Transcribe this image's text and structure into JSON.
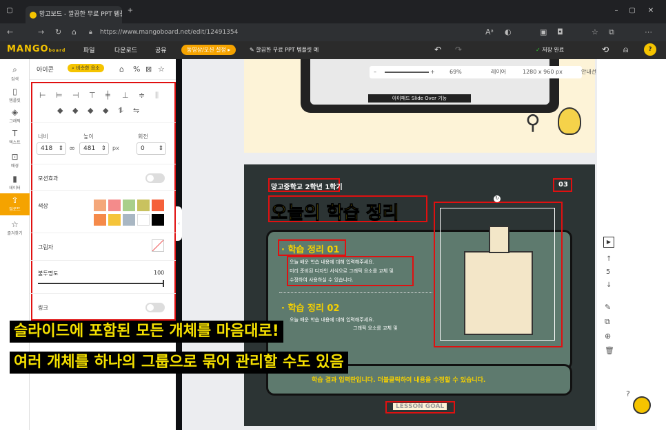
{
  "browser": {
    "tab_title": "망고보드 - 깔끔한 무료 PPT 템플릿",
    "url": "https://www.mangoboard.net/edit/12491354"
  },
  "app": {
    "logo": "MANGO",
    "logo_sub": "board",
    "menu": [
      "파일",
      "다운로드",
      "공유"
    ],
    "motion_pill": "동영상/모션 설정 ▸",
    "doc_title": "깔끔한 무료 PPT 템플릿 예",
    "saved": "저장 완료"
  },
  "sidebar": {
    "items": [
      {
        "label": "검색",
        "icon": "search-icon"
      },
      {
        "label": "템플릿",
        "icon": "template-icon"
      },
      {
        "label": "그래픽",
        "icon": "graphic-icon"
      },
      {
        "label": "텍스트",
        "icon": "text-icon"
      },
      {
        "label": "배경",
        "icon": "background-icon"
      },
      {
        "label": "데이터",
        "icon": "chart-icon"
      },
      {
        "label": "업로드",
        "icon": "upload-icon"
      },
      {
        "label": "즐겨찾기",
        "icon": "star-icon"
      }
    ]
  },
  "panel": {
    "head": "아이콘",
    "similar": "비슷한 요소",
    "width_label": "너비",
    "height_label": "높이",
    "rotate_label": "회전",
    "width": "418",
    "height": "481",
    "unit": "px",
    "rotate": "0",
    "motion": "모션효과",
    "color": "색상",
    "shadow": "그림자",
    "opacity": "불투명도",
    "opacity_value": "100",
    "opacity_level": 1.0,
    "link": "링크",
    "swatches": [
      "#f4a77a",
      "#f48b8b",
      "#a9cf8b",
      "#c9c25f",
      "#f5603a",
      "#f58a4a",
      "#f5c43a",
      "#a9b7c3",
      "#ffffff",
      "#000000"
    ]
  },
  "zoom": {
    "zoom": "69%",
    "layer": "레이어",
    "size": "1280 x 960 px",
    "guide": "안내선"
  },
  "slide1": {
    "caption": "아이패드 Slide Over 기능"
  },
  "slide2": {
    "school": "망고중학교 2학년 1학기",
    "number": "03",
    "title": "오늘의 학습 정리",
    "s1_head": "· 학습 정리 01",
    "s1_body": [
      "오늘 배운 학습 내용에 대해 입력해주세요.",
      "미리 준비된 디자인 서식으로 그래픽 요소를 교체 및",
      "수정하여 사용하실 수 있습니다."
    ],
    "s2_head": "· 학습 정리 02",
    "s2_body": [
      "오늘 배운 학습 내용에 대해 입력해주세요.",
      "그래픽 요소를 교체 및"
    ],
    "goal_text": "학습 결과 입력란입니다. 더블클릭하여 내용을 수정할 수 있습니다.",
    "goal_label": "LESSON GOAL"
  },
  "captions": [
    "슬라이드에 포함된 모든 개체를 마음대로!",
    "여러 개체를 하나의 그룹으로 묶어 관리할 수도 있음"
  ],
  "rightbar": {
    "page": "5"
  }
}
